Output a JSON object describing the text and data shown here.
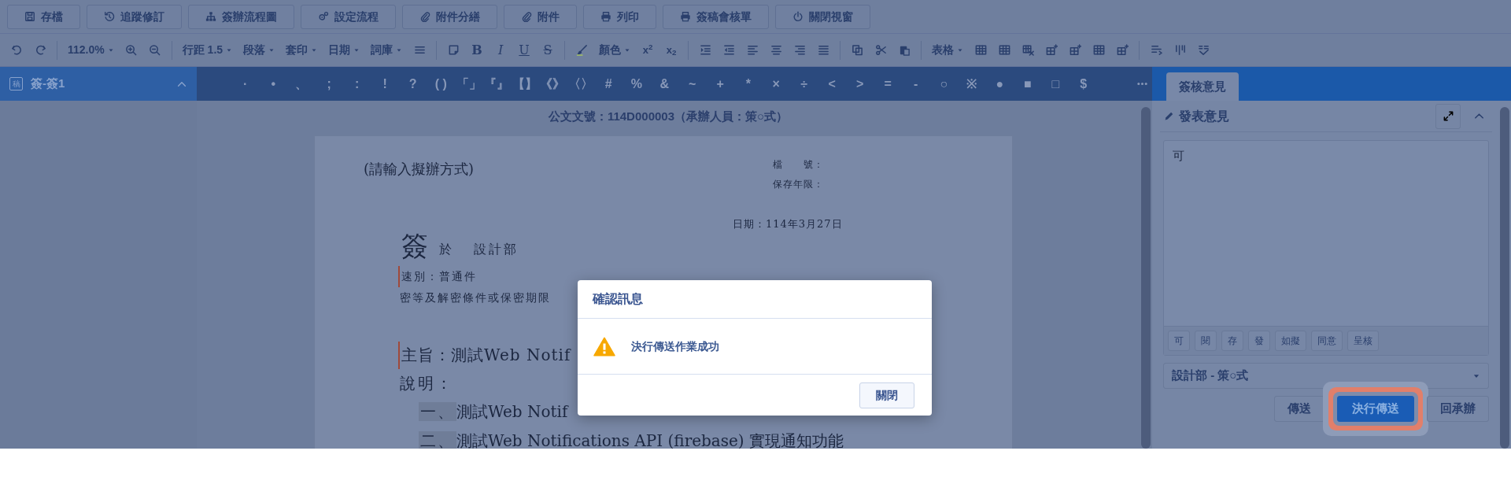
{
  "toolbar": {
    "buttons": [
      "存檔",
      "追蹤修訂",
      "簽辦流程圖",
      "設定流程",
      "附件分繕",
      "附件",
      "列印",
      "簽稿會核單",
      "關閉視窗"
    ]
  },
  "format_toolbar": {
    "zoom": "112.0%",
    "dropdowns": [
      "行距 1.5",
      "段落",
      "套印",
      "日期",
      "詞庫"
    ],
    "styles": [
      "B",
      "I",
      "U",
      "S"
    ],
    "color_label": "顏色",
    "scripts": [
      "x$^{2}$",
      "x$_{2}$"
    ],
    "table": "表格"
  },
  "sidebar": {
    "items": [
      {
        "badge": "稿",
        "label": "簽-簽1",
        "selected": true,
        "expanded": true
      }
    ]
  },
  "symbols": [
    "·",
    "•",
    "、",
    ";",
    ":",
    "!",
    "?",
    "( )",
    "「」",
    "『』",
    "【】",
    "《》",
    "〈〉",
    "#",
    "%",
    "&",
    "~",
    "+",
    "*",
    "×",
    "÷",
    "<",
    ">",
    "=",
    "-",
    "○",
    "※",
    "●",
    "■",
    "□",
    "$"
  ],
  "document": {
    "doc_number": "公文文號：114D000003（承辦人員：策○式）",
    "method": "(請輸入擬辦方式)",
    "file_fields": [
      "檔　　號：",
      "保存年限："
    ],
    "date": "日期：114年3月27日",
    "heading": {
      "main": "簽",
      "at": "於",
      "unit": "設計部"
    },
    "lines": [
      {
        "kind": "meta",
        "text": "速別：普通件",
        "marked": true
      },
      {
        "kind": "meta",
        "text": "密等及解密條件或保密期限",
        "marked": false
      },
      {
        "kind": "subject",
        "text": "主旨：測試Web Notif",
        "marked": true
      },
      {
        "kind": "heading",
        "text": "說明：",
        "marked": false
      },
      {
        "kind": "item",
        "number": "一、",
        "text": "測試Web Notif",
        "marked": false
      },
      {
        "kind": "item",
        "number": "二、",
        "text": "測試Web Notifications API (firebase) 實現通知功能",
        "marked": false
      }
    ]
  },
  "right_panel": {
    "tabs": [
      {
        "label": "簽核意見",
        "selected": true
      }
    ],
    "opinion": {
      "title": "發表意見",
      "value": "可",
      "phrases": [
        "可",
        "閱",
        "存",
        "發",
        "如擬",
        "同意",
        "呈核"
      ],
      "recipient": "設計部 - 策○式",
      "actions": [
        {
          "label": "傳送",
          "primary": false,
          "highlighted": false
        },
        {
          "label": "決行傳送",
          "primary": true,
          "highlighted": true
        },
        {
          "label": "回承辦",
          "primary": false,
          "highlighted": false
        }
      ]
    }
  },
  "dialog": {
    "title": "確認訊息",
    "kind": "warning",
    "message": "決行傳送作業成功",
    "button": "關閉"
  }
}
